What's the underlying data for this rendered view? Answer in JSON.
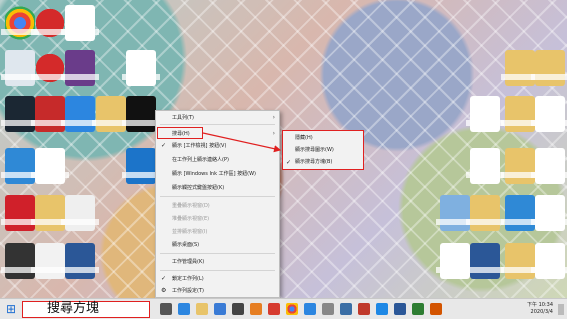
{
  "context_menu": {
    "items": [
      {
        "label": "工具列(T)",
        "arrow": true,
        "disabled": false,
        "check": false
      },
      {
        "label": "搜尋(H)",
        "arrow": true,
        "disabled": false,
        "check": false
      },
      {
        "label": "顯示 [工作檢視] 按鈕(V)",
        "arrow": false,
        "disabled": false,
        "check": true
      },
      {
        "label": "在工作列上顯示連絡人(P)",
        "arrow": false,
        "disabled": false,
        "check": false
      },
      {
        "label": "顯示 [Windows Ink 工作區] 按鈕(W)",
        "arrow": false,
        "disabled": false,
        "check": false
      },
      {
        "label": "顯示觸控式鍵盤按鈕(K)",
        "arrow": false,
        "disabled": false,
        "check": false
      },
      {
        "label": "重疊顯示視窗(D)",
        "arrow": false,
        "disabled": true,
        "check": false
      },
      {
        "label": "堆疊顯示視窗(E)",
        "arrow": false,
        "disabled": true,
        "check": false
      },
      {
        "label": "並排顯示視窗(I)",
        "arrow": false,
        "disabled": true,
        "check": false
      },
      {
        "label": "顯示桌面(S)",
        "arrow": false,
        "disabled": false,
        "check": false
      },
      {
        "label": "工作管理員(K)",
        "arrow": false,
        "disabled": false,
        "check": false
      },
      {
        "label": "鎖定工作列(L)",
        "arrow": false,
        "disabled": false,
        "check": true
      },
      {
        "label": "工作列設定(T)",
        "arrow": false,
        "disabled": false,
        "check": false
      }
    ]
  },
  "submenu": {
    "items": [
      {
        "label": "隱藏(H)",
        "check": false
      },
      {
        "label": "顯示搜尋圖示(W)",
        "check": false
      },
      {
        "label": "顯示搜尋方塊(B)",
        "check": true
      }
    ]
  },
  "taskbar": {
    "search_text": "搜尋方塊"
  },
  "clock": {
    "time": "下午 10:34",
    "date": "2020/3/4"
  },
  "colors": {
    "highlight": "#e02020",
    "accent": "#1f6fd1"
  }
}
